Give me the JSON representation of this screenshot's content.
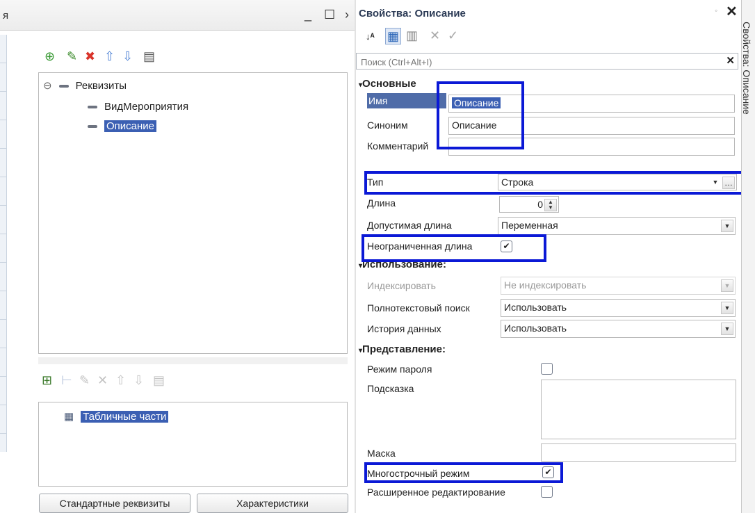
{
  "left": {
    "title_fragment": "я",
    "tree_root": "Реквизиты",
    "tree_items": [
      "ВидМероприятия",
      "Описание"
    ],
    "tabparts_root": "Табличные части",
    "btn_standard": "Стандартные реквизиты",
    "btn_characteristics": "Характеристики"
  },
  "right": {
    "title": "Свойства: Описание",
    "search_placeholder": "Поиск (Ctrl+Alt+I)",
    "groups": {
      "basic": "Основные",
      "usage": "Использование:",
      "presentation": "Представление:"
    },
    "labels": {
      "name": "Имя",
      "synonym": "Синоним",
      "comment": "Комментарий",
      "type": "Тип",
      "length": "Длина",
      "allowed_length": "Допустимая длина",
      "unlimited_length": "Неограниченная длина",
      "index": "Индексировать",
      "fulltext": "Полнотекстовый поиск",
      "history": "История данных",
      "password_mode": "Режим пароля",
      "hint": "Подсказка",
      "mask": "Маска",
      "multiline": "Многострочный режим",
      "extended_edit": "Расширенное редактирование"
    },
    "values": {
      "name": "Описание",
      "synonym": "Описание",
      "type": "Строка",
      "length": "0",
      "allowed_length": "Переменная",
      "index": "Не индексировать",
      "fulltext": "Использовать",
      "history": "Использовать"
    },
    "side_tab": "Свойства: Описание"
  },
  "colors": {
    "highlight": "#0b19d6",
    "selection": "#3b5fb3"
  }
}
